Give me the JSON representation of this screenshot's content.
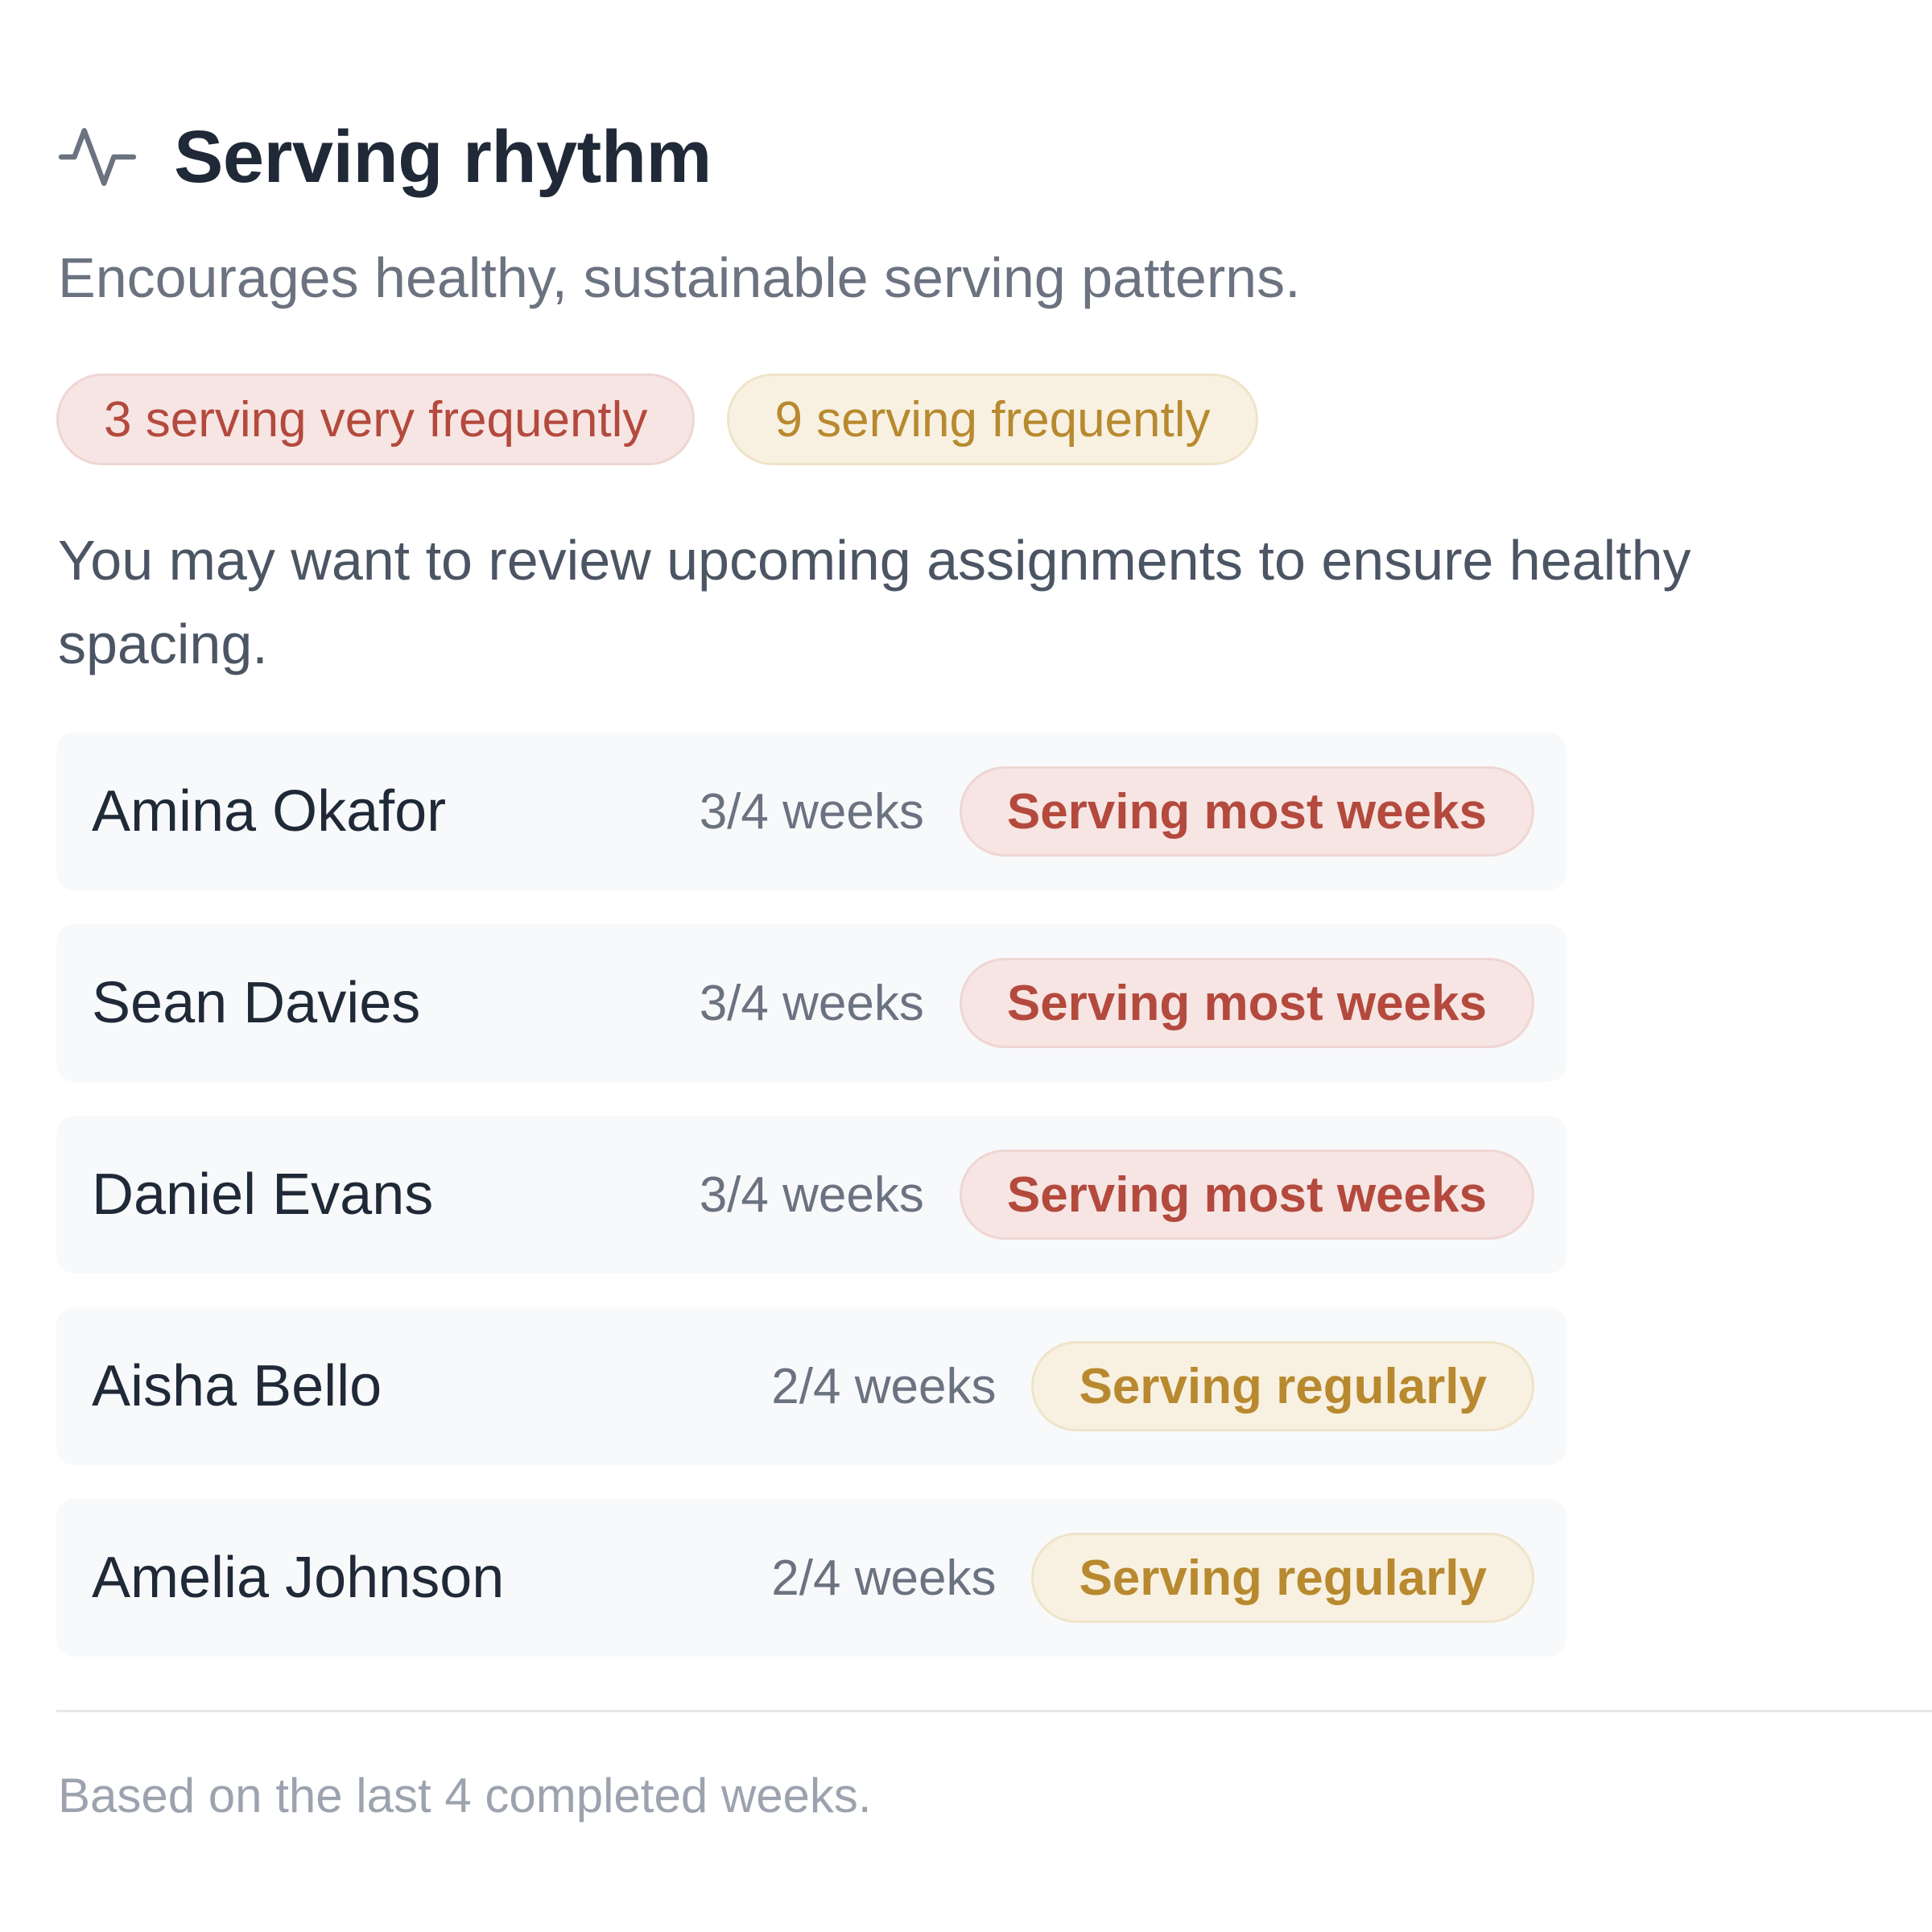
{
  "header": {
    "title": "Serving rhythm",
    "icon": "activity-pulse-icon"
  },
  "subtitle": "Encourages healthy, sustainable serving patterns.",
  "summary": {
    "very_frequent": "3 serving very frequently",
    "frequent": "9 serving frequently"
  },
  "advice": "You may want to review upcoming assignments to ensure healthy spacing.",
  "people": [
    {
      "name": "Amina Okafor",
      "weeks": "3/4 weeks",
      "status": "Serving most weeks",
      "level": "red"
    },
    {
      "name": "Sean Davies",
      "weeks": "3/4 weeks",
      "status": "Serving most weeks",
      "level": "red"
    },
    {
      "name": "Daniel Evans",
      "weeks": "3/4 weeks",
      "status": "Serving most weeks",
      "level": "red"
    },
    {
      "name": "Aisha Bello",
      "weeks": "2/4 weeks",
      "status": "Serving regularly",
      "level": "amber"
    },
    {
      "name": "Amelia Johnson",
      "weeks": "2/4 weeks",
      "status": "Serving regularly",
      "level": "amber"
    }
  ],
  "footer": "Based on the last 4 completed weeks.",
  "colors": {
    "red_text": "#b4493d",
    "red_bg": "#f6e5e3",
    "amber_text": "#b8892f",
    "amber_bg": "#f8f1e1"
  }
}
